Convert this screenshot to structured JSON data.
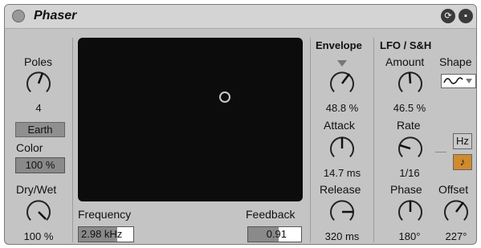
{
  "device": {
    "title": "Phaser",
    "power_icon": "power-icon",
    "hot_swap_icon": "hot-swap-icon",
    "save_icon": "save-icon"
  },
  "left": {
    "poles_label": "Poles",
    "poles_value": "4",
    "earth_button": "Earth",
    "color_label": "Color",
    "color_value": "100 %",
    "drywet_label": "Dry/Wet",
    "drywet_value": "100 %"
  },
  "xy_pad": {
    "frequency_label": "Frequency",
    "frequency_value": "2.98 kHz",
    "feedback_label": "Feedback",
    "feedback_value": "0.91",
    "feedback_fill": 0.58
  },
  "envelope": {
    "header": "Envelope",
    "amount_value": "48.8 %",
    "attack_label": "Attack",
    "attack_value": "14.7 ms",
    "release_label": "Release",
    "release_value": "320 ms"
  },
  "lfo": {
    "header": "LFO / S&H",
    "amount_label": "Amount",
    "amount_value": "46.5 %",
    "shape_label": "Shape",
    "shape_icon": "sine-wave-icon",
    "rate_label": "Rate",
    "rate_value": "1/16",
    "hz_button": "Hz",
    "sync_icon": "note-icon",
    "phase_label": "Phase",
    "phase_value": "180°",
    "offset_label": "Offset",
    "offset_value": "227°"
  }
}
